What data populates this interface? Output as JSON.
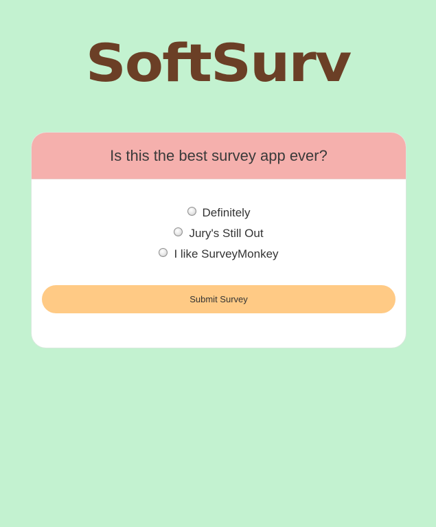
{
  "app": {
    "logo_text": "SoftSurv"
  },
  "survey": {
    "question": "Is this the best survey app ever?",
    "options": [
      {
        "label": "Definitely",
        "selected": false
      },
      {
        "label": "Jury's Still Out",
        "selected": false
      },
      {
        "label": "I like SurveyMonkey",
        "selected": false
      }
    ],
    "submit_label": "Submit Survey"
  },
  "colors": {
    "background": "#c3f2d0",
    "logo": "#6b3f26",
    "header": "#f5b0ad",
    "button": "#ffca85"
  }
}
